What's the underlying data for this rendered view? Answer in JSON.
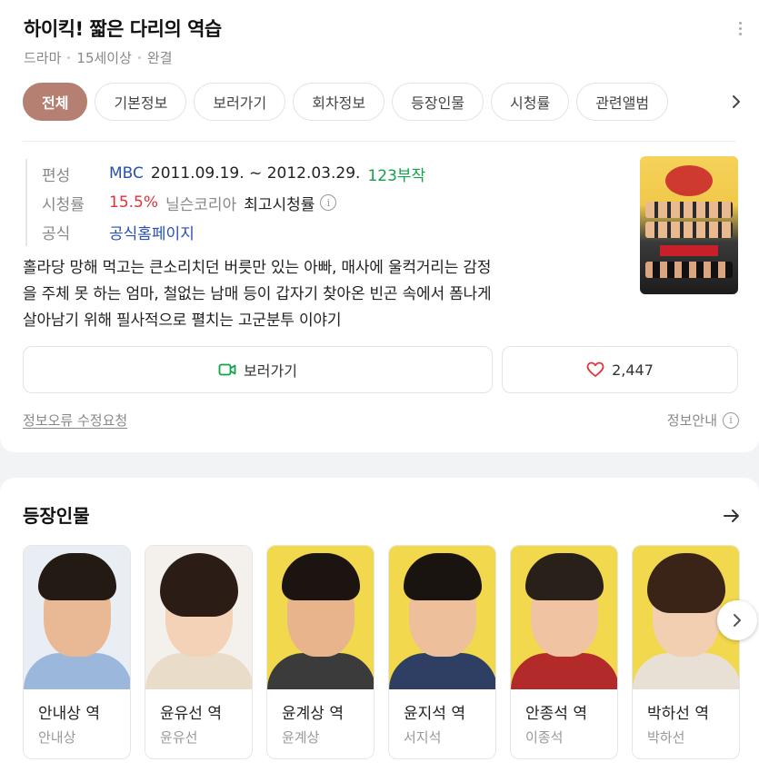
{
  "header": {
    "title": "하이킥! 짧은 다리의 역습",
    "meta": [
      "드라마",
      "15세이상",
      "완결"
    ]
  },
  "tabs": [
    "전체",
    "기본정보",
    "보러가기",
    "회차정보",
    "등장인물",
    "시청률",
    "관련앨범"
  ],
  "info": {
    "broadcast_label": "편성",
    "channel": "MBC",
    "period": "2011.09.19. ~ 2012.03.29.",
    "episodes": "123부작",
    "rating_label": "시청률",
    "rating": "15.5%",
    "rating_source": "닐슨코리아",
    "rating_note": "최고시청률",
    "official_label": "공식",
    "official_link": "공식홈페이지"
  },
  "synopsis": [
    "홀라당 망해 먹고는 큰소리치던 버릇만 있는 아빠, 매사에 울컥거리는 감정",
    "을 주체 못 하는 엄마, 철없는 남매 등이 갑자기 찾아온 빈곤 속에서 폼나게",
    "살아남기 위해 필사적으로 펼치는 고군분투 이야기"
  ],
  "actions": {
    "watch_label": "보러가기",
    "like_count": "2,447"
  },
  "footer": {
    "report_label": "정보오류 수정요청",
    "info_label": "정보안내"
  },
  "cast_section": {
    "title": "등장인물",
    "members": [
      {
        "role": "안내상 역",
        "actor": "안내상"
      },
      {
        "role": "윤유선 역",
        "actor": "윤유선"
      },
      {
        "role": "윤계상 역",
        "actor": "윤계상"
      },
      {
        "role": "윤지석 역",
        "actor": "서지석"
      },
      {
        "role": "안종석 역",
        "actor": "이종석"
      },
      {
        "role": "박하선 역",
        "actor": "박하선"
      }
    ]
  },
  "colors": {
    "accent": "#b57f72",
    "link": "#2a4fb8",
    "episodes": "#10a44a",
    "rating": "#e0323a"
  },
  "icons": [
    "more-vertical-icon",
    "chevron-right-icon",
    "info-circle-icon",
    "video-camera-icon",
    "heart-icon",
    "arrow-right-icon"
  ]
}
